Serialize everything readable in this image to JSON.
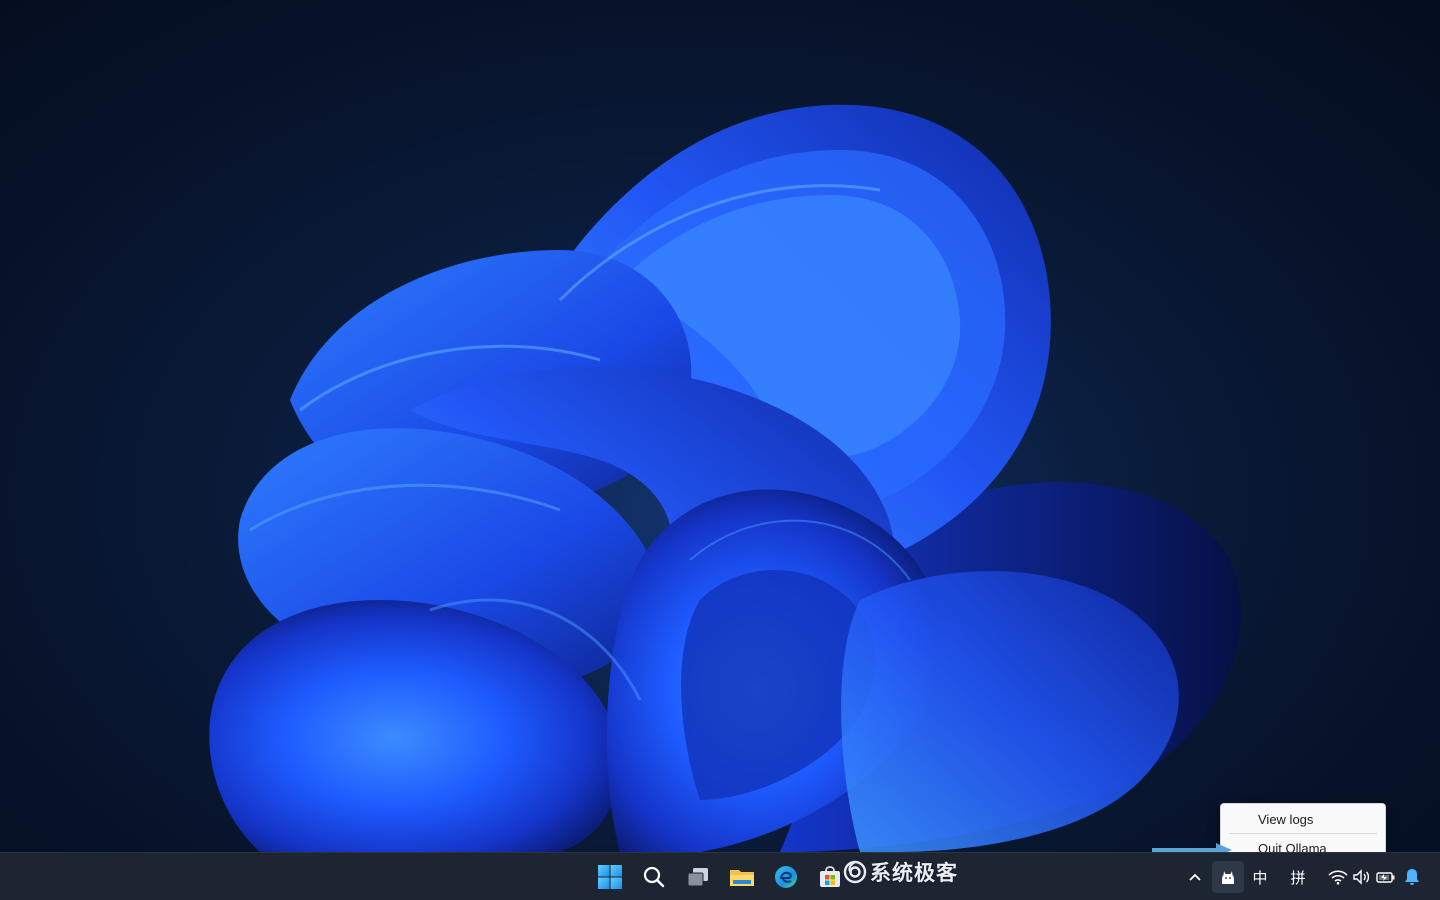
{
  "context_menu": {
    "items": [
      {
        "label": "View logs"
      },
      {
        "label": "Quit Ollama"
      }
    ]
  },
  "taskbar": {
    "pinned": [
      {
        "icon": "windows-start-icon"
      },
      {
        "icon": "search-icon"
      },
      {
        "icon": "task-view-icon"
      },
      {
        "icon": "file-explorer-icon"
      },
      {
        "icon": "edge-browser-icon"
      },
      {
        "icon": "microsoft-store-icon"
      }
    ],
    "tray": {
      "ime_language": "中",
      "ime_mode": "拼",
      "icons": [
        "chevron-up-icon",
        "ollama-icon",
        "wifi-icon",
        "volume-icon",
        "battery-icon",
        "notification-bell-icon"
      ]
    }
  },
  "watermark": {
    "text": "系统极客"
  },
  "colors": {
    "taskbar_bg": "#1d2533",
    "menu_bg": "#f9f9f9",
    "annotation_arrow": "#5aa2d6",
    "wallpaper_bloom": "#1f5cff",
    "desktop_bg": "#07132a"
  }
}
